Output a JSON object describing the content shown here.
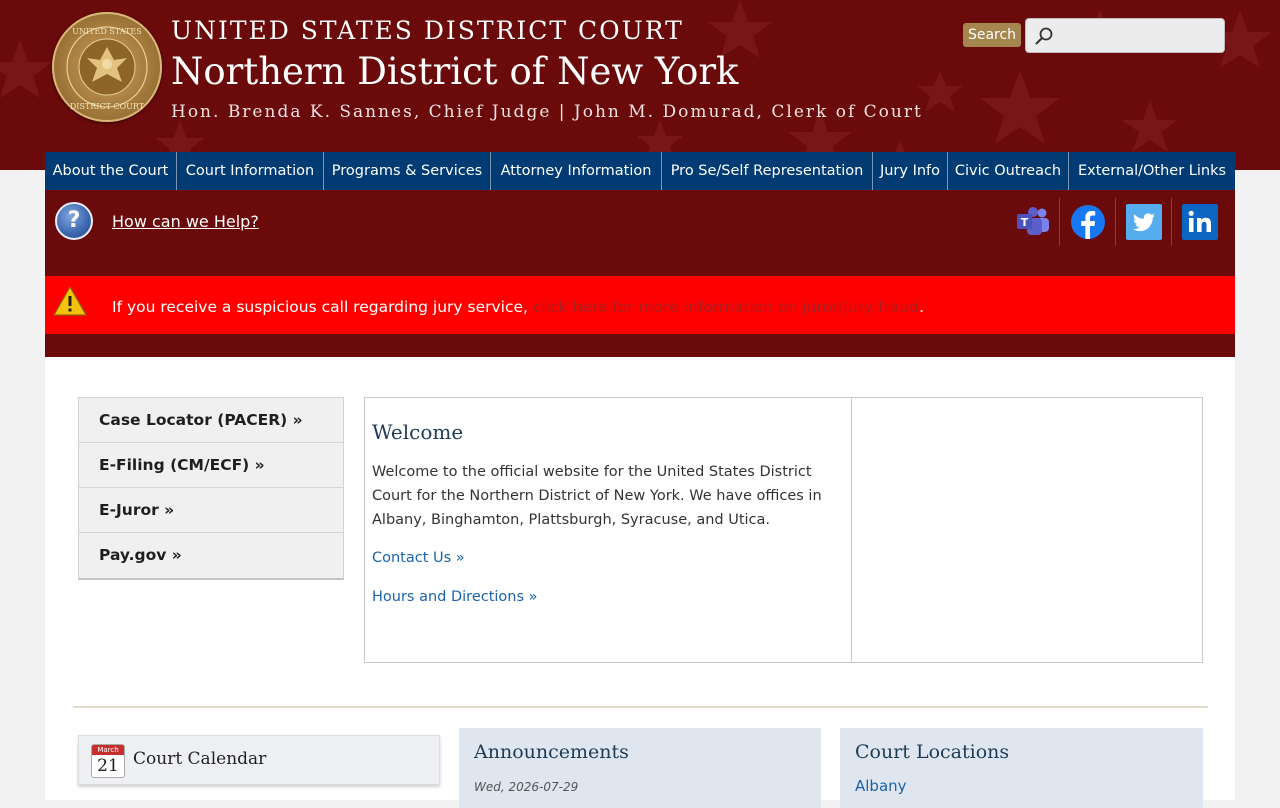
{
  "header": {
    "line1": "UNITED STATES DISTRICT COURT",
    "line2": "Northern District of New York",
    "line3": "Hon. Brenda K. Sannes, Chief Judge | John M. Domurad, Clerk of Court",
    "seal_text_top": "UNITED STATES",
    "seal_text_bottom": "DISTRICT COURT",
    "search_button": "Search",
    "search_placeholder": ""
  },
  "nav": {
    "items": [
      "About the Court",
      "Court Information",
      "Programs & Services",
      "Attorney Information",
      "Pro Se/Self Representation",
      "Jury Info",
      "Civic Outreach",
      "External/Other Links"
    ]
  },
  "help": {
    "link": "How can we Help?",
    "social": [
      "microsoft-teams-icon",
      "facebook-icon",
      "twitter-icon",
      "linkedin-icon"
    ]
  },
  "alert": {
    "text": "If you receive a suspicious call regarding jury service, ",
    "link": "click here for more information on juror/jury fraud",
    "end": "."
  },
  "quicklinks": [
    "Case Locator (PACER) »",
    "E-Filing (CM/ECF) »",
    "E-Juror »",
    "Pay.gov »"
  ],
  "welcome": {
    "title": "Welcome",
    "text": "Welcome to the official website for the United States District Court for the Northern District of New York. We have offices in Albany, Binghamton, Plattsburgh, Syracuse, and Utica.",
    "contact": "Contact Us »",
    "hours": "Hours and Directions »"
  },
  "calendar": {
    "month": "March",
    "day": "21",
    "title": "Court Calendar"
  },
  "announcements": {
    "title": "Announcements",
    "date": "Wed, 2026-07-29"
  },
  "locations": {
    "title": "Court Locations",
    "first": "Albany"
  },
  "colors": {
    "header_bg": "#6a0a0b",
    "nav_bg": "#003b73",
    "alert_bg": "#ff0000",
    "search_btn": "#a5864e",
    "link": "#1a63a8"
  }
}
